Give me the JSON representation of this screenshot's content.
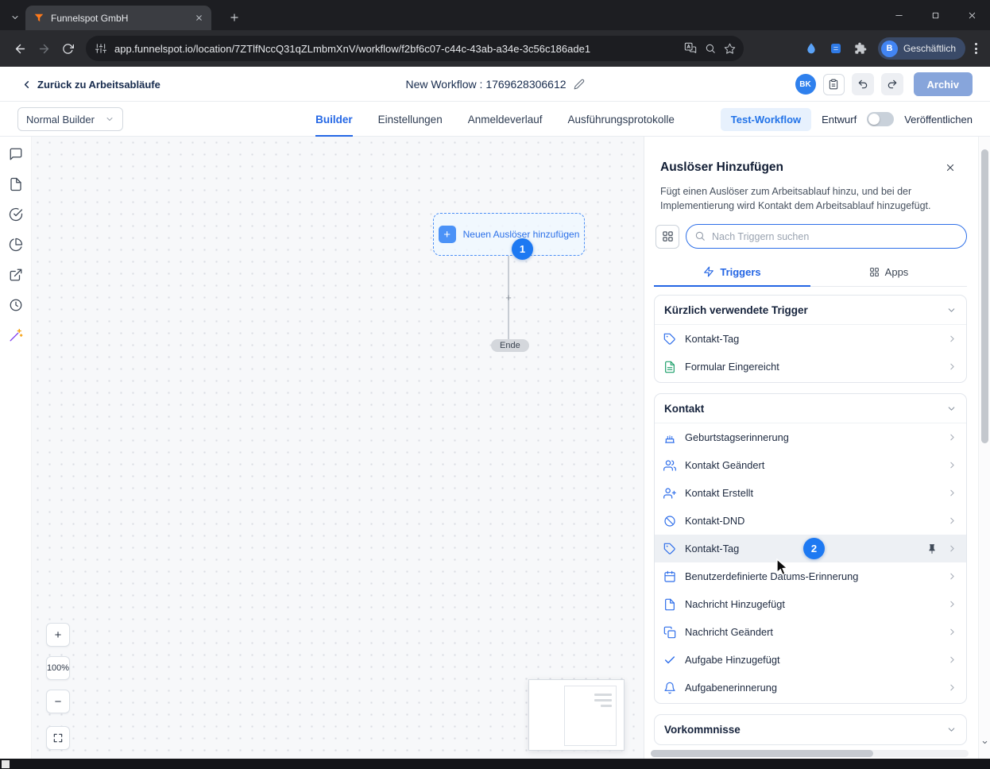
{
  "colors": {
    "accent": "#2563eb",
    "badge_blue": "#1d79f2",
    "archive_button": "#87a5db",
    "test_pill_bg": "#e7f1fd",
    "highlight_row": "#edf0f4"
  },
  "browser": {
    "tab_title": "Funnelspot GmbH",
    "url": "app.funnelspot.io/location/7ZTlfNccQ31qZLmbmXnV/workflow/f2bf6c07-c44c-43ab-a34e-3c56c186ade1",
    "profile_initial": "B",
    "profile_label": "Geschäftlich"
  },
  "header": {
    "back_label": "Zurück zu Arbeitsabläufe",
    "workflow_title": "New Workflow : 1769628306612",
    "avatar_initials": "BK",
    "archive_label": "Archiv"
  },
  "subheader": {
    "builder_select": "Normal Builder",
    "tabs": [
      {
        "label": "Builder",
        "active": true
      },
      {
        "label": "Einstellungen"
      },
      {
        "label": "Anmeldeverlauf"
      },
      {
        "label": "Ausführungsprotokolle"
      }
    ],
    "test_workflow_label": "Test-Workflow",
    "draft_label": "Entwurf",
    "publish_label": "Veröffentlichen"
  },
  "canvas": {
    "add_trigger_label": "Neuen Auslöser hinzufügen",
    "step_badge_1": "1",
    "connector_plus": "+",
    "end_label": "Ende",
    "zoom_in": "+",
    "zoom_level": "100%",
    "zoom_out": "−"
  },
  "panel": {
    "title": "Auslöser Hinzufügen",
    "description": "Fügt einen Auslöser zum Arbeitsablauf hinzu, und bei der Implementierung wird Kontakt dem Arbeitsablauf hinzugefügt.",
    "search_placeholder": "Nach Triggern suchen",
    "tabs": {
      "triggers": "Triggers",
      "apps": "Apps"
    },
    "step_badge_2": "2",
    "sections": {
      "recent": {
        "title": "Kürzlich verwendete Trigger",
        "items": [
          {
            "label": "Kontakt-Tag",
            "icon": "tag-icon"
          },
          {
            "label": "Formular Eingereicht",
            "icon": "form-submitted-icon"
          }
        ]
      },
      "kontakt": {
        "title": "Kontakt",
        "items": [
          {
            "label": "Geburtstagserinnerung",
            "icon": "birthday-icon"
          },
          {
            "label": "Kontakt Geändert",
            "icon": "contact-changed-icon"
          },
          {
            "label": "Kontakt Erstellt",
            "icon": "contact-created-icon"
          },
          {
            "label": "Kontakt-DND",
            "icon": "dnd-icon"
          },
          {
            "label": "Kontakt-Tag",
            "icon": "tag-icon",
            "highlighted": true,
            "pinned": true
          },
          {
            "label": "Benutzerdefinierte Datums-Erinnerung",
            "icon": "calendar-icon"
          },
          {
            "label": "Nachricht Hinzugefügt",
            "icon": "message-added-icon"
          },
          {
            "label": "Nachricht Geändert",
            "icon": "message-changed-icon"
          },
          {
            "label": "Aufgabe Hinzugefügt",
            "icon": "task-added-icon"
          },
          {
            "label": "Aufgabenerinnerung",
            "icon": "task-reminder-icon"
          }
        ]
      },
      "vorkommnisse": {
        "title": "Vorkommnisse"
      }
    }
  }
}
